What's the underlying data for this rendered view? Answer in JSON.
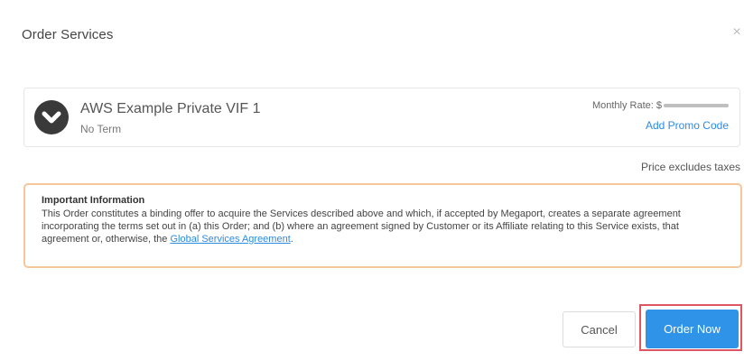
{
  "dialog": {
    "title": "Order Services",
    "close_glyph": "×"
  },
  "service": {
    "icon": "chevron-down-icon",
    "name": "AWS Example Private VIF 1",
    "term": "No Term",
    "rate_label": "Monthly Rate: $",
    "promo_link": "Add Promo Code"
  },
  "tax_note": "Price excludes taxes",
  "info": {
    "title": "Important Information",
    "body": "This Order constitutes a binding offer to acquire the Services described above and which, if accepted by Megaport, creates a separate agreement incorporating the terms set out in (a) this Order; and (b) where an agreement signed by Customer or its Affiliate relating to this Service exists, that agreement or, otherwise, the ",
    "link_text": "Global Services Agreement",
    "body_end": "."
  },
  "buttons": {
    "cancel": "Cancel",
    "order_now": "Order Now"
  },
  "colors": {
    "accent": "#2f93e8",
    "link": "#2d8be0",
    "warning_border": "#f5c79b",
    "highlight": "#e05562"
  }
}
